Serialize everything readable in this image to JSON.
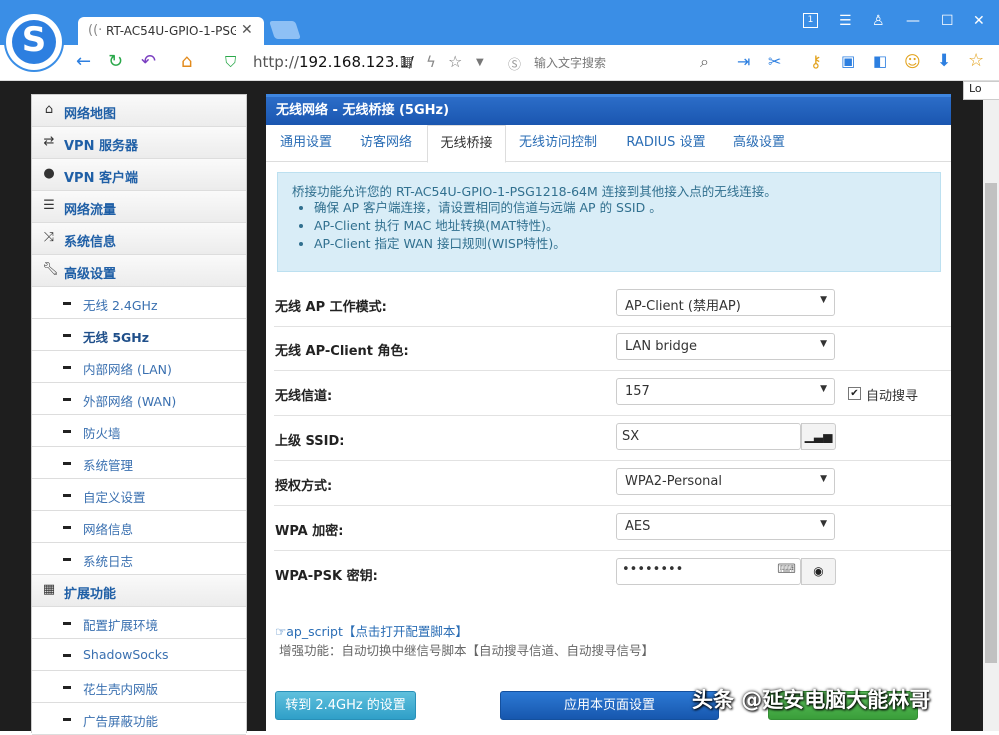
{
  "browser": {
    "tab_title": "RT-AC54U-GPIO-1-PSG",
    "address_prefix": "http://",
    "address_host": "192.168.123.1/",
    "search_placeholder": "输入文字搜索",
    "corner_label": "Lo"
  },
  "sidebar": {
    "items": [
      {
        "label": "网络地图",
        "icon": "home-icon"
      },
      {
        "label": "VPN 服务器",
        "icon": "exchange-icon"
      },
      {
        "label": "VPN 客户端",
        "icon": "globe-icon"
      },
      {
        "label": "网络流量",
        "icon": "list-icon"
      },
      {
        "label": "系统信息",
        "icon": "random-icon"
      },
      {
        "label": "高级设置",
        "icon": "wrench-icon"
      }
    ],
    "advanced_sub": [
      {
        "label": "无线 2.4GHz"
      },
      {
        "label": "无线 5GHz"
      },
      {
        "label": "内部网络 (LAN)"
      },
      {
        "label": "外部网络 (WAN)"
      },
      {
        "label": "防火墙"
      },
      {
        "label": "系统管理"
      },
      {
        "label": "自定义设置"
      },
      {
        "label": "网络信息"
      },
      {
        "label": "系统日志"
      }
    ],
    "ext_label": "扩展功能",
    "ext_sub": [
      {
        "label": "配置扩展环境"
      },
      {
        "label": "ShadowSocks"
      },
      {
        "label": "花生壳内网版"
      },
      {
        "label": "广告屏蔽功能"
      }
    ]
  },
  "panel": {
    "title": "无线网络 - 无线桥接 (5GHz)",
    "tabs": [
      "通用设置",
      "访客网络",
      "无线桥接",
      "无线访问控制",
      "RADIUS 设置",
      "高级设置"
    ],
    "info_intro": "桥接功能允许您的 RT-AC54U-GPIO-1-PSG1218-64M 连接到其他接入点的无线连接。",
    "info_bullets": [
      "确保 AP 客户端连接，请设置相同的信道与远端 AP 的 SSID 。",
      "AP-Client 执行 MAC 地址转换(MAT特性)。",
      "AP-Client 指定 WAN 接口规则(WISP特性)。"
    ]
  },
  "form": {
    "ap_mode_label": "无线 AP 工作模式:",
    "ap_mode_value": "AP-Client (禁用AP)",
    "role_label": "无线 AP-Client 角色:",
    "role_value": "LAN bridge",
    "channel_label": "无线信道:",
    "channel_value": "157",
    "auto_search_label": "自动搜寻",
    "ssid_label": "上级 SSID:",
    "ssid_value": "SX",
    "auth_label": "授权方式:",
    "auth_value": "WPA2-Personal",
    "enc_label": "WPA 加密:",
    "enc_value": "AES",
    "psk_label": "WPA-PSK 密钥:",
    "psk_value": "••••••••"
  },
  "script": {
    "link": "ap_script【点击打开配置脚本】",
    "desc": "增强功能：自动切换中继信号脚本【自动搜寻信道、自动搜寻信号】"
  },
  "buttons": {
    "goto24": "转到 2.4GHz 的设置",
    "apply": "应用本页面设置"
  },
  "watermark": "头条 @延安电脑大能林哥"
}
